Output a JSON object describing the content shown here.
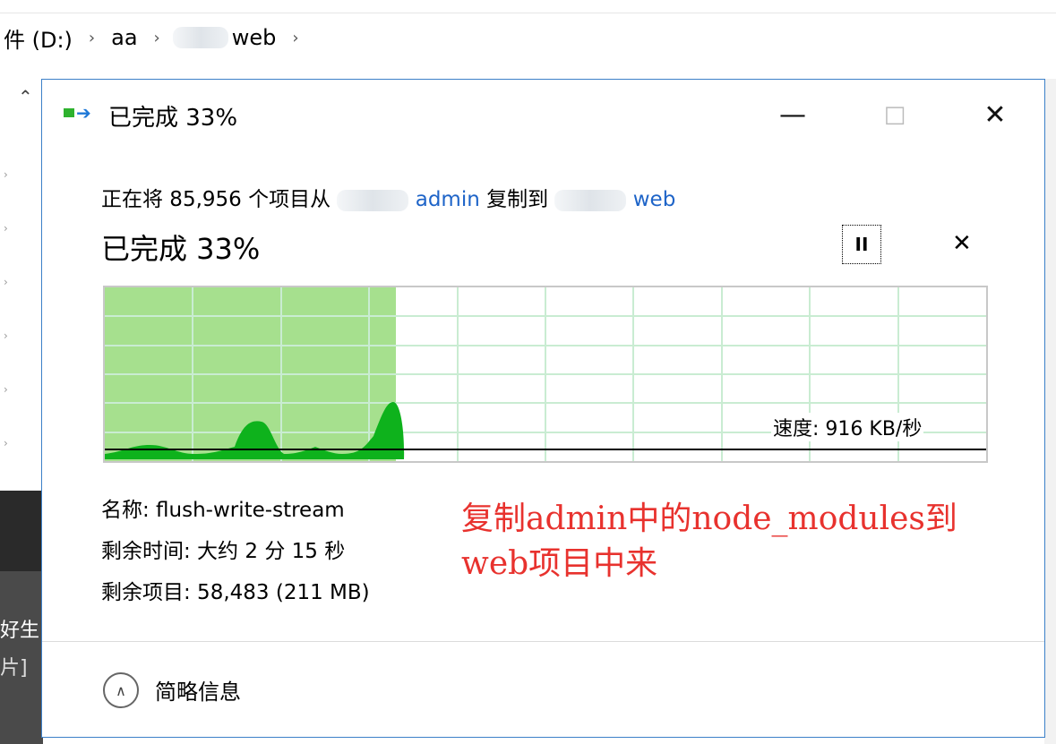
{
  "explorer": {
    "breadcrumb": [
      "件 (D:)",
      "aa",
      "web"
    ],
    "left_text": [
      "好生",
      "片]"
    ],
    "scroll_up_icon": "chevron-up-icon"
  },
  "dialog": {
    "title": "已完成 33%",
    "title_icon": "copy-progress-icon",
    "window_buttons": {
      "minimize": "—",
      "maximize": "□",
      "close": "✕"
    },
    "copy_prefix": "正在将 85,956 个项目从",
    "source": "admin",
    "middle": "复制到",
    "destination": "web",
    "progress_title": "已完成 33%",
    "progress_percent": 33,
    "pause_label": "II",
    "stop_label": "✕",
    "speed": "速度: 916 KB/秒",
    "name_line": "名称: flush-write-stream",
    "time_line": "剩余时间: 大约 2 分 15 秒",
    "items_line": "剩余项目: 58,483 (211 MB)",
    "collapse_label": "简略信息",
    "colors": {
      "progress_fill": "#a6e08e",
      "speed_fill": "#0eb21c",
      "grid": "#c9ecd2",
      "border": "#3c80c8",
      "annotation": "#e8322e"
    }
  },
  "annotation": {
    "line1": "复制admin中的node_modules到",
    "line2": "web项目中来"
  }
}
